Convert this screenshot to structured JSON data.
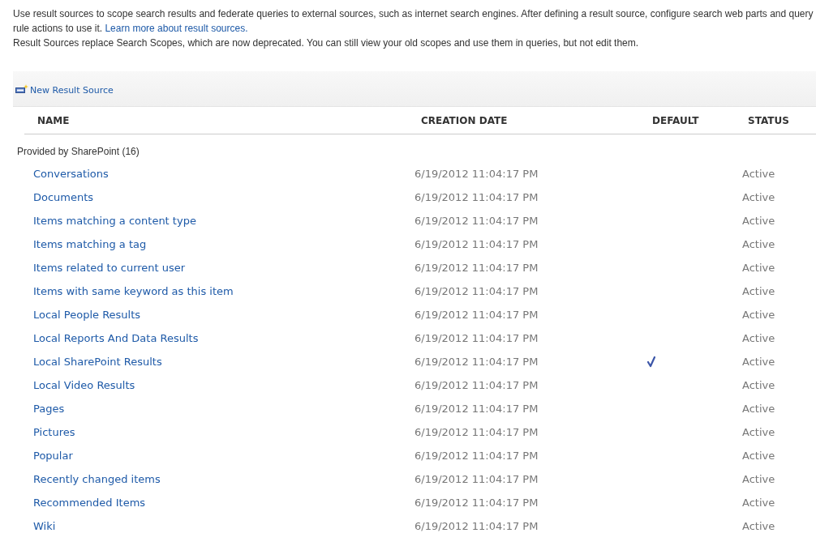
{
  "intro": {
    "text": "Use result sources to scope search results and federate queries to external sources, such as internet search engines. After defining a result source, configure search web parts and query rule actions to use it.",
    "link": "Learn more about result sources.",
    "note": "Result Sources replace Search Scopes, which are now deprecated. You can still view your old scopes and use them in queries, but not edit them."
  },
  "toolbar": {
    "new_button": "New Result Source"
  },
  "table": {
    "columns": [
      "NAME",
      "CREATION DATE",
      "DEFAULT",
      "STATUS"
    ],
    "group": "Provided by SharePoint (16)",
    "rows": [
      {
        "name": "Conversations",
        "date": "6/19/2012 11:04:17 PM",
        "default": false,
        "status": "Active"
      },
      {
        "name": "Documents",
        "date": "6/19/2012 11:04:17 PM",
        "default": false,
        "status": "Active"
      },
      {
        "name": "Items matching a content type",
        "date": "6/19/2012 11:04:17 PM",
        "default": false,
        "status": "Active"
      },
      {
        "name": "Items matching a tag",
        "date": "6/19/2012 11:04:17 PM",
        "default": false,
        "status": "Active"
      },
      {
        "name": "Items related to current user",
        "date": "6/19/2012 11:04:17 PM",
        "default": false,
        "status": "Active"
      },
      {
        "name": "Items with same keyword as this item",
        "date": "6/19/2012 11:04:17 PM",
        "default": false,
        "status": "Active"
      },
      {
        "name": "Local People Results",
        "date": "6/19/2012 11:04:17 PM",
        "default": false,
        "status": "Active"
      },
      {
        "name": "Local Reports And Data Results",
        "date": "6/19/2012 11:04:17 PM",
        "default": false,
        "status": "Active"
      },
      {
        "name": "Local SharePoint Results",
        "date": "6/19/2012 11:04:17 PM",
        "default": true,
        "status": "Active"
      },
      {
        "name": "Local Video Results",
        "date": "6/19/2012 11:04:17 PM",
        "default": false,
        "status": "Active"
      },
      {
        "name": "Pages",
        "date": "6/19/2012 11:04:17 PM",
        "default": false,
        "status": "Active"
      },
      {
        "name": "Pictures",
        "date": "6/19/2012 11:04:17 PM",
        "default": false,
        "status": "Active"
      },
      {
        "name": "Popular",
        "date": "6/19/2012 11:04:17 PM",
        "default": false,
        "status": "Active"
      },
      {
        "name": "Recently changed items",
        "date": "6/19/2012 11:04:17 PM",
        "default": false,
        "status": "Active"
      },
      {
        "name": "Recommended Items",
        "date": "6/19/2012 11:04:17 PM",
        "default": false,
        "status": "Active"
      },
      {
        "name": "Wiki",
        "date": "6/19/2012 11:04:17 PM",
        "default": false,
        "status": "Active"
      }
    ]
  }
}
